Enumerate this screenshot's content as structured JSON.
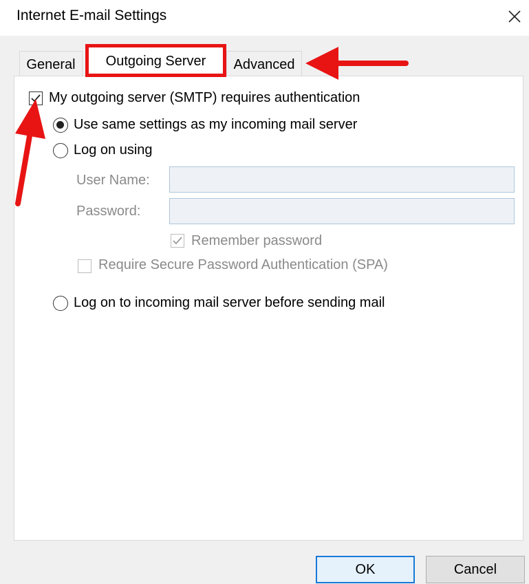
{
  "window": {
    "title": "Internet E-mail Settings",
    "close_icon": "close-icon"
  },
  "tabs": [
    {
      "label": "General"
    },
    {
      "label": "Outgoing Server",
      "active": true,
      "highlight_color": "#e81414"
    },
    {
      "label": "Advanced"
    }
  ],
  "outgoing": {
    "requires_auth": {
      "label": "My outgoing server (SMTP) requires authentication",
      "checked": true
    },
    "use_same": {
      "label": "Use same settings as my incoming mail server",
      "selected": true
    },
    "log_on_using": {
      "label": "Log on using",
      "selected": false
    },
    "user_name": {
      "label": "User Name:",
      "value": ""
    },
    "password": {
      "label": "Password:",
      "value": ""
    },
    "remember_password": {
      "label": "Remember password",
      "checked": true,
      "disabled": true
    },
    "require_spa": {
      "label": "Require Secure Password Authentication (SPA)",
      "checked": false,
      "disabled": true
    },
    "log_on_incoming": {
      "label": "Log on to incoming mail server before sending mail",
      "selected": false
    }
  },
  "buttons": {
    "ok": "OK",
    "cancel": "Cancel"
  },
  "annotation_color": "#e81414"
}
